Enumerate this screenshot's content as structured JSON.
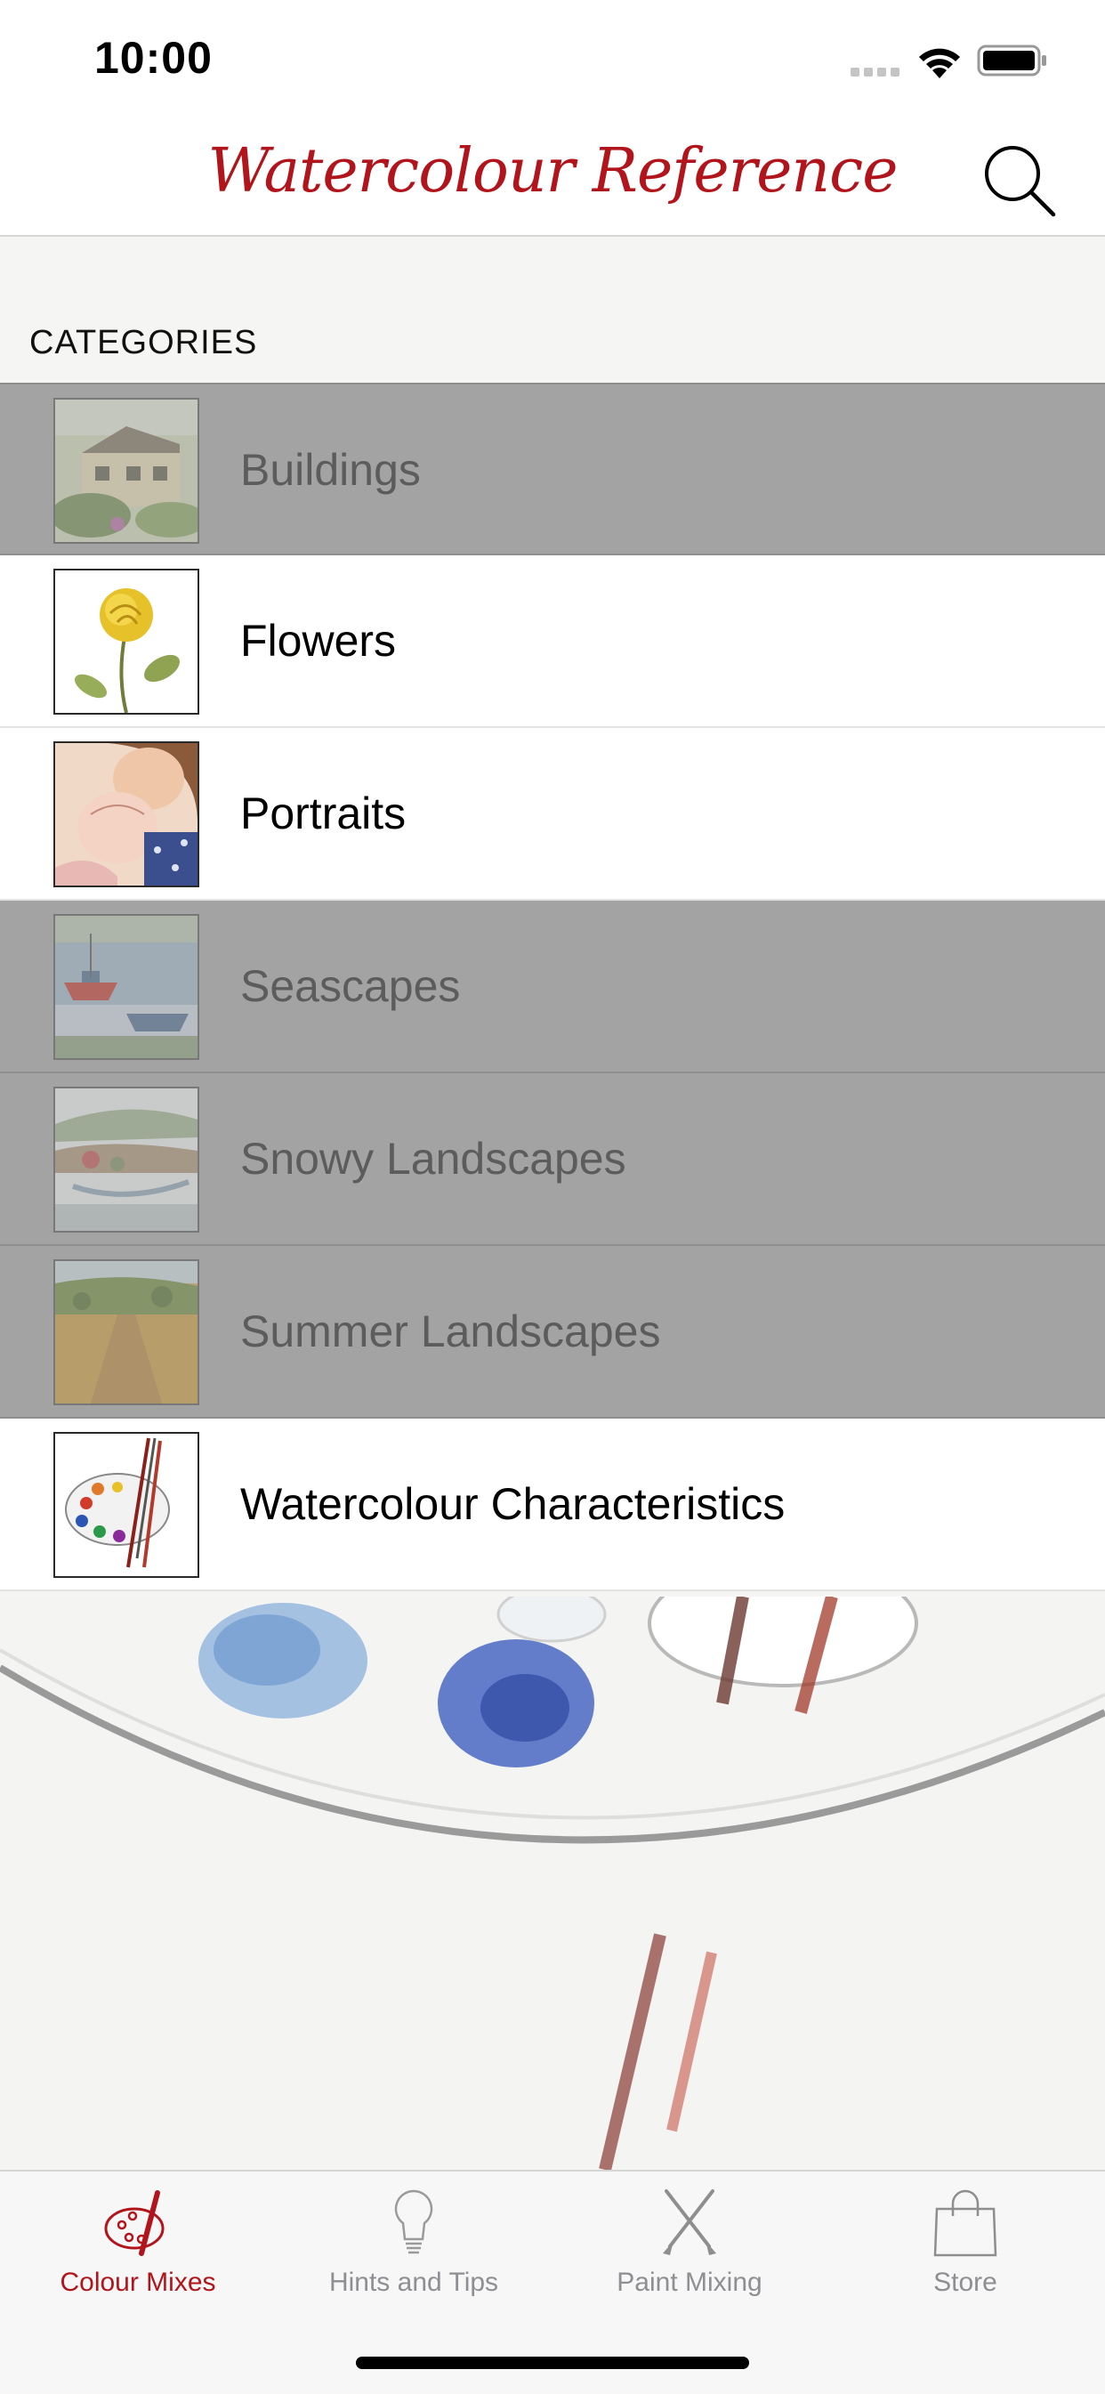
{
  "status_bar": {
    "time": "10:00"
  },
  "nav": {
    "title": "Watercolour Reference"
  },
  "section": {
    "header": "CATEGORIES"
  },
  "categories": [
    {
      "label": "Buildings",
      "enabled": false
    },
    {
      "label": "Flowers",
      "enabled": true
    },
    {
      "label": "Portraits",
      "enabled": true
    },
    {
      "label": "Seascapes",
      "enabled": false
    },
    {
      "label": "Snowy Landscapes",
      "enabled": false
    },
    {
      "label": "Summer Landscapes",
      "enabled": false
    },
    {
      "label": "Watercolour Characteristics",
      "enabled": true
    }
  ],
  "tabs": [
    {
      "label": "Colour Mixes",
      "icon": "palette-icon",
      "active": true
    },
    {
      "label": "Hints and Tips",
      "icon": "lightbulb-icon",
      "active": false
    },
    {
      "label": "Paint Mixing",
      "icon": "brushes-icon",
      "active": false
    },
    {
      "label": "Store",
      "icon": "shopping-bag-icon",
      "active": false
    }
  ],
  "colors": {
    "accent": "#b2141b",
    "disabled_row": "#a3a3a3",
    "tab_inactive": "#8e8e93"
  }
}
